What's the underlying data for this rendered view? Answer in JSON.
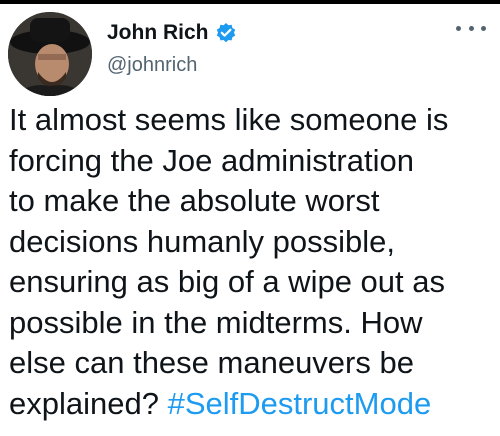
{
  "author": {
    "display_name": "John Rich",
    "handle": "@johnrich",
    "verified_icon": "verified-badge-icon",
    "verified_color": "#1d9bf0",
    "avatar_icon": "profile-avatar"
  },
  "menu": {
    "more_icon": "more-options-icon"
  },
  "tweet": {
    "lines": [
      "It almost seems like someone is",
      "forcing the Joe administration",
      "to make the absolute worst",
      "decisions humanly possible,",
      "ensuring as big of a wipe out as",
      "possible in the midterms. How",
      "else can these maneuvers be"
    ],
    "last_line_text": "explained? ",
    "hashtag": "#SelfDestructMode",
    "hashtag_color": "#1d9bf0"
  }
}
